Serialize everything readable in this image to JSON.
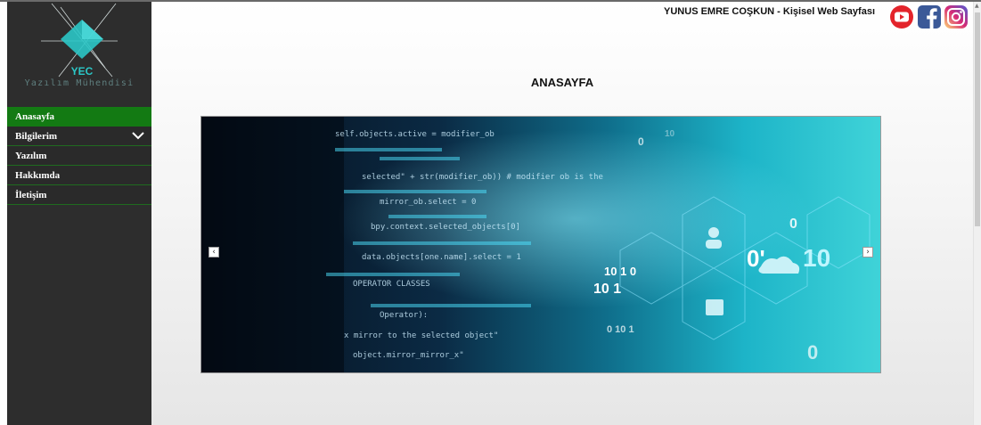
{
  "header": {
    "site_title": "YUNUS EMRE COŞKUN - Kişisel Web Sayfası"
  },
  "logo": {
    "mark": "YEC",
    "caption": "Yazılım Mühendisi"
  },
  "sidebar": {
    "items": [
      {
        "label": "Anasayfa",
        "active": true
      },
      {
        "label": "Bilgilerim",
        "has_submenu": true
      },
      {
        "label": "Yazılım"
      },
      {
        "label": "Hakkımda"
      },
      {
        "label": "İletişim"
      }
    ]
  },
  "social": [
    "youtube-icon",
    "facebook-icon",
    "instagram-icon"
  ],
  "main": {
    "page_title": "ANASAYFA",
    "carousel": {
      "prev": "‹",
      "next": "›",
      "code_lines": [
        "self.objects.active = modifier_ob",
        "selected\" + str(modifier_ob)) # modifier ob is the",
        "mirror_ob.select = 0",
        "bpy.context.selected_objects[0]",
        "data.objects[one.name].select = 1",
        "OPERATOR CLASSES",
        "Operator):",
        "x mirror to the selected object\"",
        "object.mirror_mirror_x\""
      ],
      "digits": [
        "0",
        "10",
        "0",
        "10",
        "0'",
        "10 1 0",
        "10 1",
        "0",
        "0 10 1"
      ]
    }
  },
  "colors": {
    "sidebar_bg": "#2d2d2d",
    "nav_active": "#137a13",
    "nav_border": "#1f6b1f",
    "logo_teal": "#2bc7c7",
    "youtube_red": "#e3242b",
    "facebook_blue": "#3b5998",
    "instagram_gradient": [
      "#feda75",
      "#d62976",
      "#4f5bd5"
    ]
  }
}
